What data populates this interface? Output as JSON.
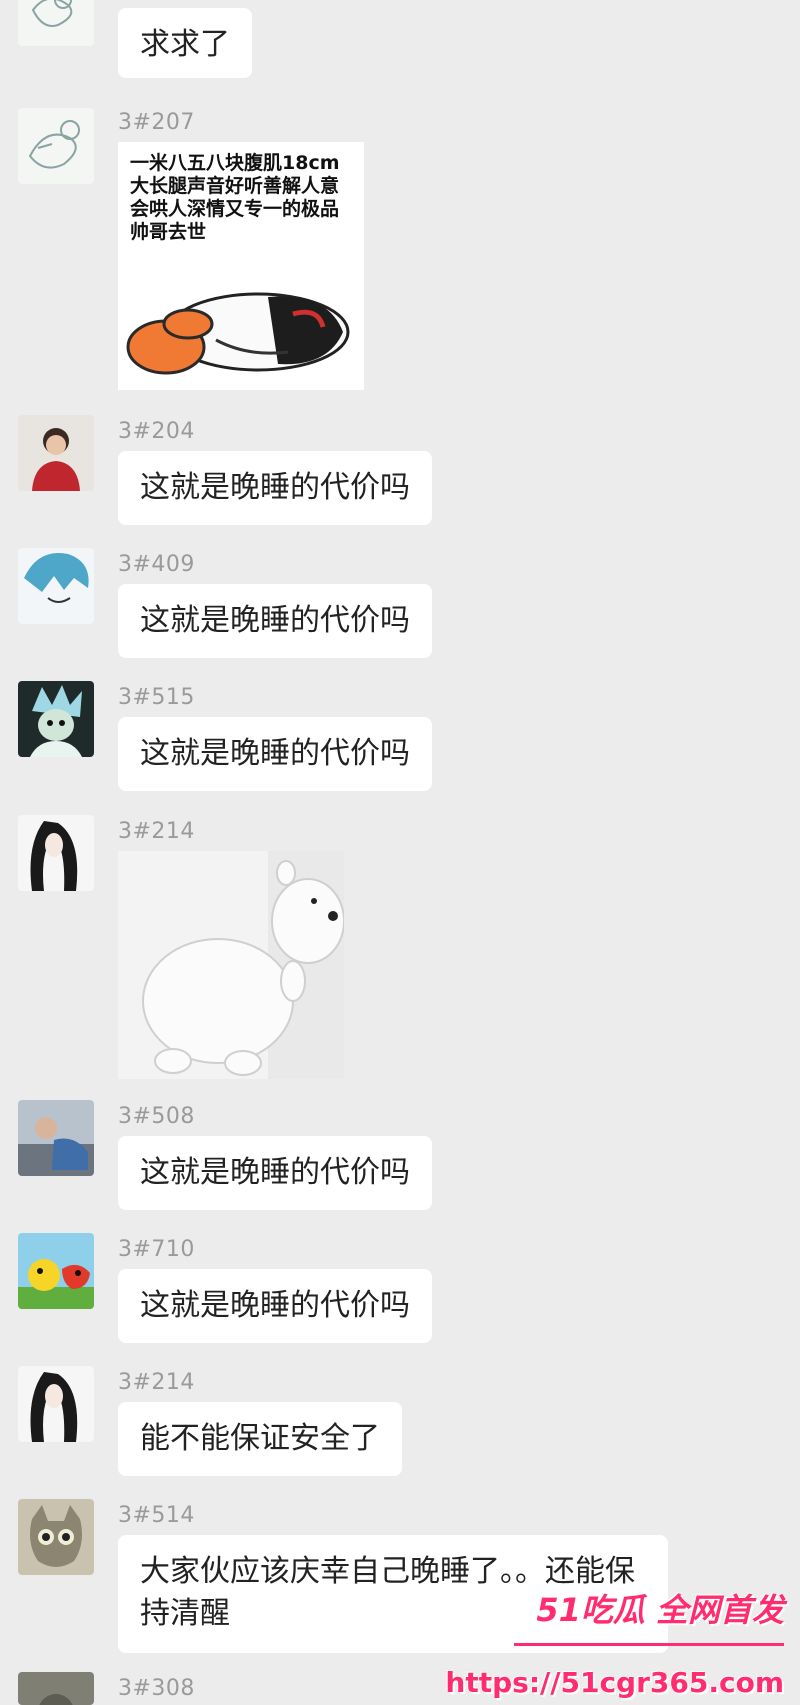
{
  "messages": [
    {
      "sender": "",
      "text": "求求了",
      "avatar_icon": "sketch-avatar-icon"
    },
    {
      "sender": "3#207",
      "sticker_text": "一米八五八块腹肌18cm大长腿声音好听善解人意会哄人深情又专一的极品帅哥去世",
      "sticker_icon": "fallen-cartoon-character-icon"
    },
    {
      "sender": "3#204",
      "text": "这就是晚睡的代价吗",
      "avatar_icon": "red-jacket-person-avatar-icon"
    },
    {
      "sender": "3#409",
      "text": "这就是晚睡的代价吗",
      "avatar_icon": "blue-hair-anime-avatar-icon"
    },
    {
      "sender": "3#515",
      "text": "这就是晚睡的代价吗",
      "avatar_icon": "cartoon-scientist-avatar-icon"
    },
    {
      "sender": "3#214",
      "sticker_icon": "white-bear-peeking-icon",
      "avatar_icon": "long-hair-sketch-avatar-icon"
    },
    {
      "sender": "3#508",
      "text": "这就是晚睡的代价吗",
      "avatar_icon": "person-photo-avatar-icon"
    },
    {
      "sender": "3#710",
      "text": "这就是晚睡的代价吗",
      "avatar_icon": "yellow-chick-avatar-icon"
    },
    {
      "sender": "3#214",
      "text": "能不能保证安全了",
      "avatar_icon": "long-hair-sketch-avatar-icon"
    },
    {
      "sender": "3#514",
      "text": "大家伙应该庆幸自己晚睡了。。还能保持清醒",
      "avatar_icon": "cat-avatar-icon"
    },
    {
      "sender": "3#308",
      "avatar_icon": "partial-avatar-icon"
    }
  ],
  "watermark": {
    "logo": "51吃瓜 全网首发",
    "url": "https://51cgr365.com"
  },
  "colors": {
    "background": "#ececec",
    "bubble": "#ffffff",
    "sender_text": "#9a9a9a",
    "watermark": "#ff2d6f"
  }
}
